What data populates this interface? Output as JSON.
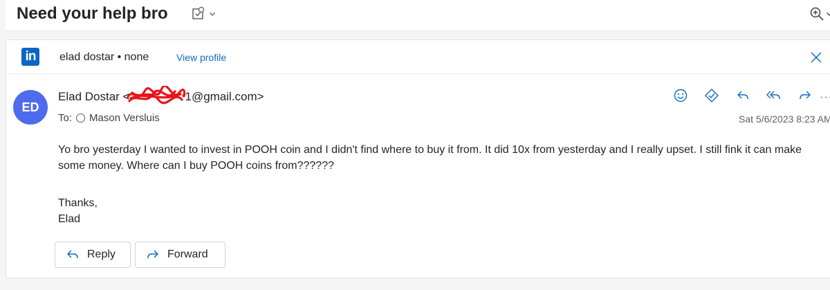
{
  "subject": "Need your help bro",
  "linkedin": {
    "logo_text": "in",
    "name_line": "elad dostar • none",
    "view_profile": "View profile"
  },
  "sender": {
    "initials": "ED",
    "name": "Elad Dostar <",
    "email_suffix": "1@gmail.com>",
    "to_label": "To:",
    "recipient": "Mason Versluis"
  },
  "timestamp": "Sat 5/6/2023 8:23 AM",
  "body": {
    "paragraph": "Yo bro yesterday I wanted to invest in POOH coin and I didn't find where to buy it from. It did 10x from yesterday and I really upset. I still fink it can make some money. Where can I buy POOH coins from??????",
    "signoff_line1": "Thanks,",
    "signoff_line2": "Elad"
  },
  "buttons": {
    "reply": "Reply",
    "forward": "Forward",
    "more": "···"
  },
  "colors": {
    "accent": "#0f6cbd",
    "avatar": "#4f6bed",
    "linkedin": "#0a66c2",
    "redaction": "#e8141b"
  },
  "icons": [
    "tag-icon",
    "chevron-down-icon",
    "zoom-in-icon",
    "linkedin-icon",
    "close-icon",
    "emoji-icon",
    "approve-icon",
    "reply-icon",
    "reply-all-icon",
    "forward-icon",
    "more-icon"
  ]
}
